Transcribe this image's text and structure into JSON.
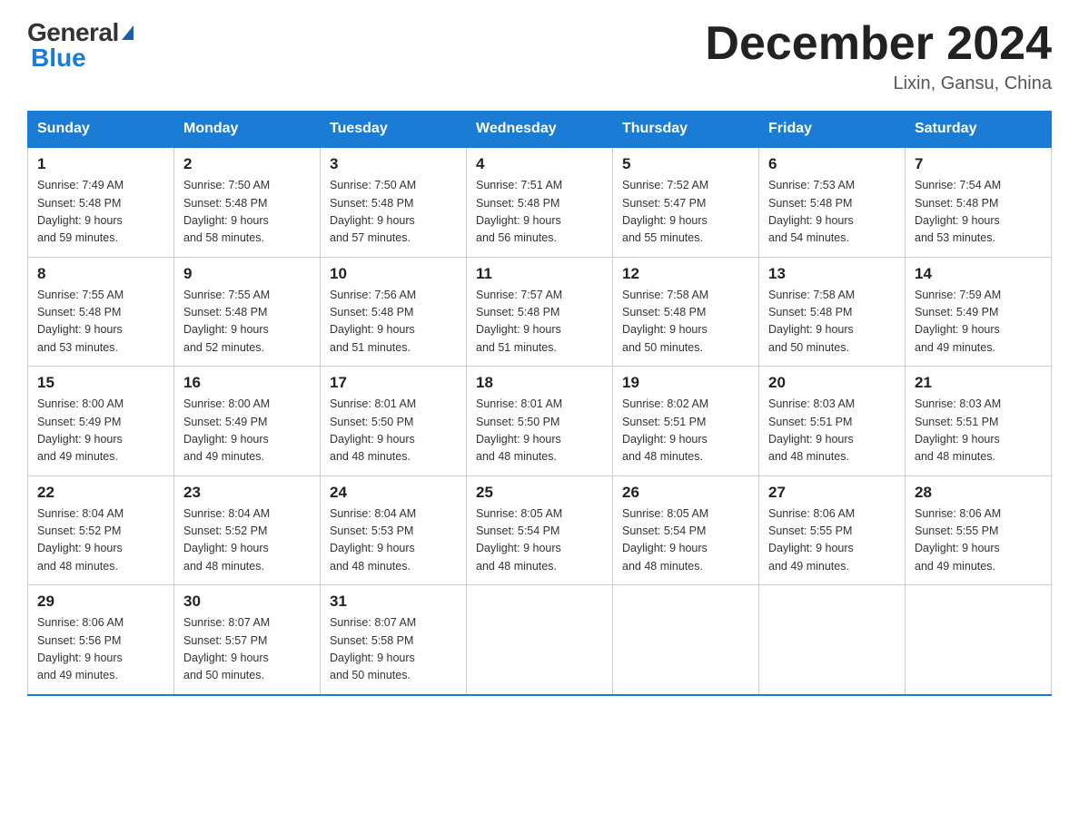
{
  "header": {
    "logo_general": "General",
    "logo_blue": "Blue",
    "month_year": "December 2024",
    "location": "Lixin, Gansu, China"
  },
  "days_of_week": [
    "Sunday",
    "Monday",
    "Tuesday",
    "Wednesday",
    "Thursday",
    "Friday",
    "Saturday"
  ],
  "weeks": [
    [
      {
        "num": "1",
        "sunrise": "7:49 AM",
        "sunset": "5:48 PM",
        "daylight": "9 hours and 59 minutes."
      },
      {
        "num": "2",
        "sunrise": "7:50 AM",
        "sunset": "5:48 PM",
        "daylight": "9 hours and 58 minutes."
      },
      {
        "num": "3",
        "sunrise": "7:50 AM",
        "sunset": "5:48 PM",
        "daylight": "9 hours and 57 minutes."
      },
      {
        "num": "4",
        "sunrise": "7:51 AM",
        "sunset": "5:48 PM",
        "daylight": "9 hours and 56 minutes."
      },
      {
        "num": "5",
        "sunrise": "7:52 AM",
        "sunset": "5:47 PM",
        "daylight": "9 hours and 55 minutes."
      },
      {
        "num": "6",
        "sunrise": "7:53 AM",
        "sunset": "5:48 PM",
        "daylight": "9 hours and 54 minutes."
      },
      {
        "num": "7",
        "sunrise": "7:54 AM",
        "sunset": "5:48 PM",
        "daylight": "9 hours and 53 minutes."
      }
    ],
    [
      {
        "num": "8",
        "sunrise": "7:55 AM",
        "sunset": "5:48 PM",
        "daylight": "9 hours and 53 minutes."
      },
      {
        "num": "9",
        "sunrise": "7:55 AM",
        "sunset": "5:48 PM",
        "daylight": "9 hours and 52 minutes."
      },
      {
        "num": "10",
        "sunrise": "7:56 AM",
        "sunset": "5:48 PM",
        "daylight": "9 hours and 51 minutes."
      },
      {
        "num": "11",
        "sunrise": "7:57 AM",
        "sunset": "5:48 PM",
        "daylight": "9 hours and 51 minutes."
      },
      {
        "num": "12",
        "sunrise": "7:58 AM",
        "sunset": "5:48 PM",
        "daylight": "9 hours and 50 minutes."
      },
      {
        "num": "13",
        "sunrise": "7:58 AM",
        "sunset": "5:48 PM",
        "daylight": "9 hours and 50 minutes."
      },
      {
        "num": "14",
        "sunrise": "7:59 AM",
        "sunset": "5:49 PM",
        "daylight": "9 hours and 49 minutes."
      }
    ],
    [
      {
        "num": "15",
        "sunrise": "8:00 AM",
        "sunset": "5:49 PM",
        "daylight": "9 hours and 49 minutes."
      },
      {
        "num": "16",
        "sunrise": "8:00 AM",
        "sunset": "5:49 PM",
        "daylight": "9 hours and 49 minutes."
      },
      {
        "num": "17",
        "sunrise": "8:01 AM",
        "sunset": "5:50 PM",
        "daylight": "9 hours and 48 minutes."
      },
      {
        "num": "18",
        "sunrise": "8:01 AM",
        "sunset": "5:50 PM",
        "daylight": "9 hours and 48 minutes."
      },
      {
        "num": "19",
        "sunrise": "8:02 AM",
        "sunset": "5:51 PM",
        "daylight": "9 hours and 48 minutes."
      },
      {
        "num": "20",
        "sunrise": "8:03 AM",
        "sunset": "5:51 PM",
        "daylight": "9 hours and 48 minutes."
      },
      {
        "num": "21",
        "sunrise": "8:03 AM",
        "sunset": "5:51 PM",
        "daylight": "9 hours and 48 minutes."
      }
    ],
    [
      {
        "num": "22",
        "sunrise": "8:04 AM",
        "sunset": "5:52 PM",
        "daylight": "9 hours and 48 minutes."
      },
      {
        "num": "23",
        "sunrise": "8:04 AM",
        "sunset": "5:52 PM",
        "daylight": "9 hours and 48 minutes."
      },
      {
        "num": "24",
        "sunrise": "8:04 AM",
        "sunset": "5:53 PM",
        "daylight": "9 hours and 48 minutes."
      },
      {
        "num": "25",
        "sunrise": "8:05 AM",
        "sunset": "5:54 PM",
        "daylight": "9 hours and 48 minutes."
      },
      {
        "num": "26",
        "sunrise": "8:05 AM",
        "sunset": "5:54 PM",
        "daylight": "9 hours and 48 minutes."
      },
      {
        "num": "27",
        "sunrise": "8:06 AM",
        "sunset": "5:55 PM",
        "daylight": "9 hours and 49 minutes."
      },
      {
        "num": "28",
        "sunrise": "8:06 AM",
        "sunset": "5:55 PM",
        "daylight": "9 hours and 49 minutes."
      }
    ],
    [
      {
        "num": "29",
        "sunrise": "8:06 AM",
        "sunset": "5:56 PM",
        "daylight": "9 hours and 49 minutes."
      },
      {
        "num": "30",
        "sunrise": "8:07 AM",
        "sunset": "5:57 PM",
        "daylight": "9 hours and 50 minutes."
      },
      {
        "num": "31",
        "sunrise": "8:07 AM",
        "sunset": "5:58 PM",
        "daylight": "9 hours and 50 minutes."
      },
      null,
      null,
      null,
      null
    ]
  ]
}
